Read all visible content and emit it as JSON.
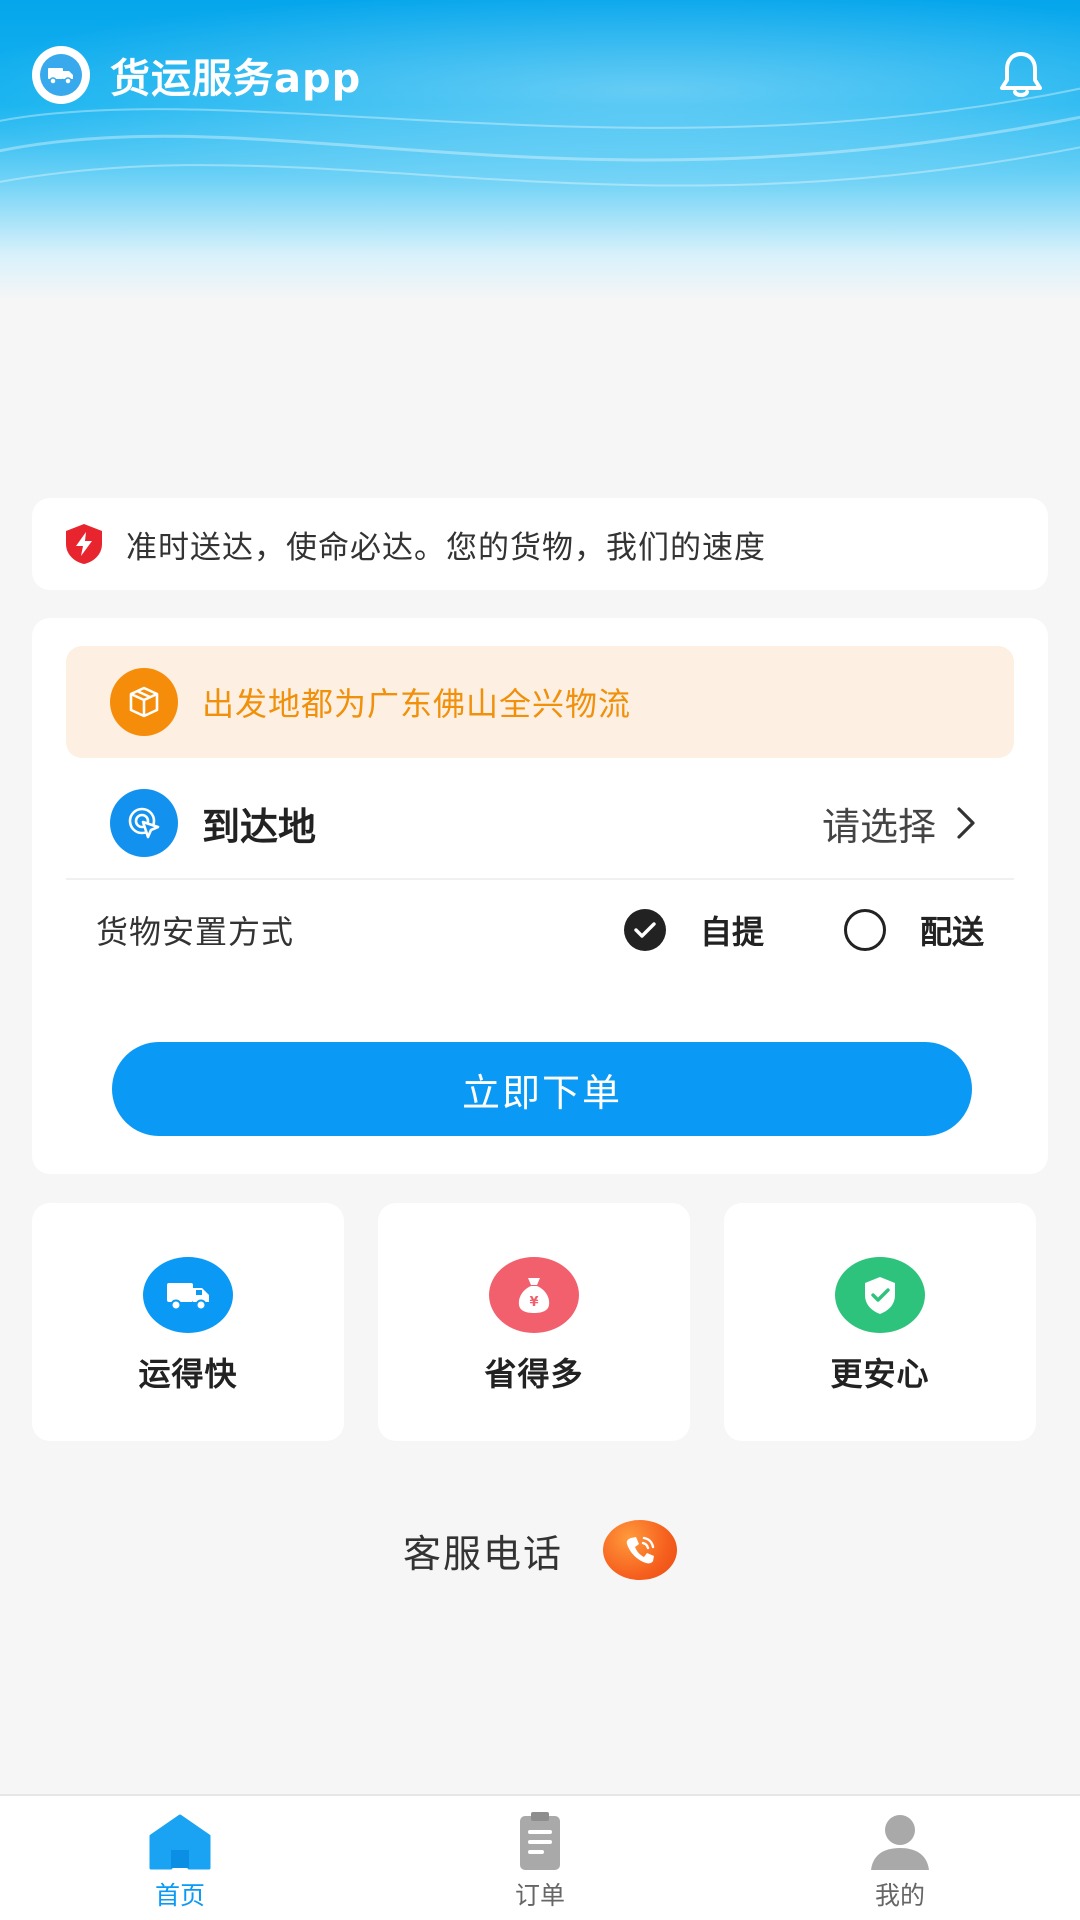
{
  "header": {
    "title": "货运服务app"
  },
  "slogan": {
    "text": "准时送达，使命必达。您的货物，我们的速度"
  },
  "order_form": {
    "origin_text": "出发地都为广东佛山全兴物流",
    "destination_label": "到达地",
    "destination_placeholder": "请选择",
    "method_label": "货物安置方式",
    "method_options": [
      {
        "label": "自提",
        "selected": true
      },
      {
        "label": "配送",
        "selected": false
      }
    ],
    "submit_label": "立即下单"
  },
  "features": [
    {
      "label": "运得快",
      "icon": "truck-icon",
      "color": "#0a99f5"
    },
    {
      "label": "省得多",
      "icon": "money-bag-icon",
      "color": "#f2606d"
    },
    {
      "label": "更安心",
      "icon": "shield-check-icon",
      "color": "#2dc37c"
    }
  ],
  "customer_service": {
    "label": "客服电话"
  },
  "bottom_nav": [
    {
      "label": "首页",
      "active": true
    },
    {
      "label": "订单",
      "active": false
    },
    {
      "label": "我的",
      "active": false
    }
  ],
  "colors": {
    "primary": "#0a99f5",
    "origin_text": "#f0900b",
    "origin_bg": "#fdf0e2"
  }
}
